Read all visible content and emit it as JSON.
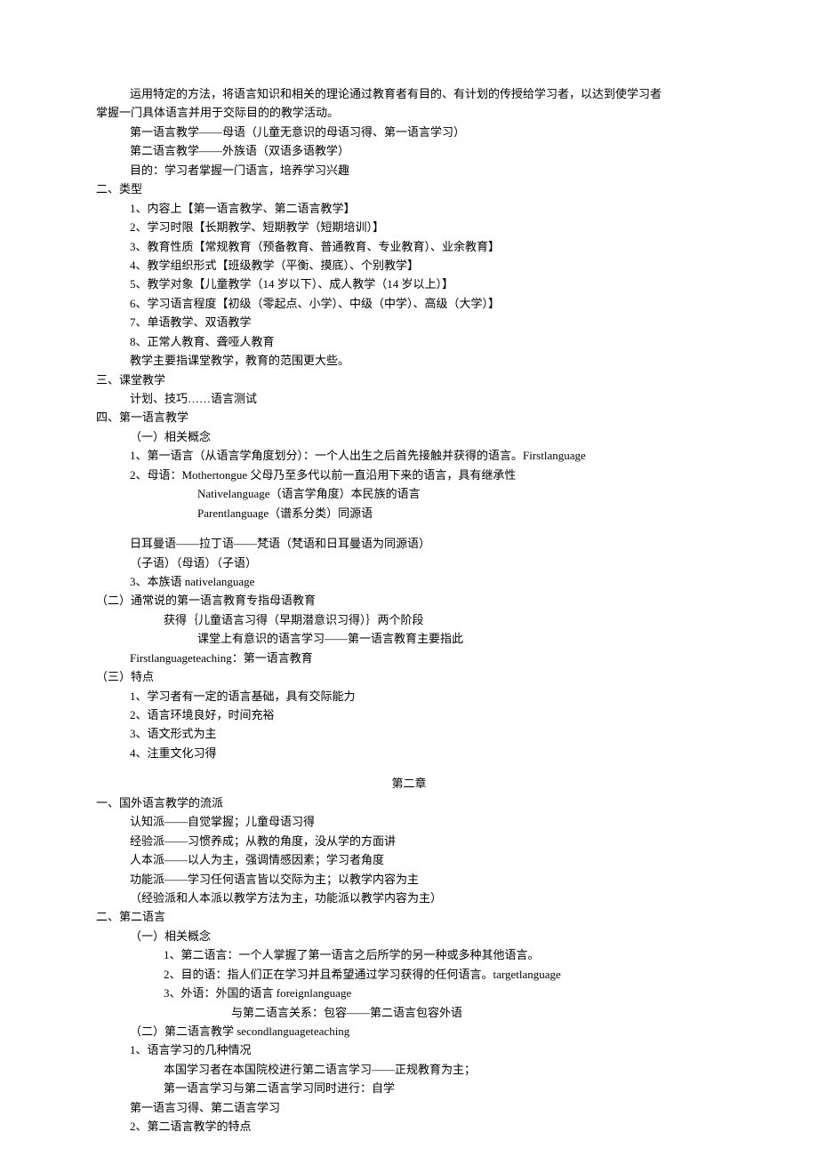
{
  "lines": [
    {
      "cls": "indent-1",
      "text": "运用特定的方法，将语言知识和相关的理论通过教育者有目的、有计划的传授给学习者，以达到使学习者"
    },
    {
      "cls": "section-num",
      "text": "掌握一门具体语言并用于交际目的的教学活动。"
    },
    {
      "cls": "indent-1",
      "text": "第一语言教学——母语（儿童无意识的母语习得、第一语言学习）"
    },
    {
      "cls": "indent-1",
      "text": "第二语言教学——外族语（双语多语教学）"
    },
    {
      "cls": "indent-1",
      "text": "目的：学习者掌握一门语言，培养学习兴趣"
    },
    {
      "cls": "section-num",
      "text": "二、类型"
    },
    {
      "cls": "indent-1",
      "text": "1、内容上【第一语言教学、第二语言教学】"
    },
    {
      "cls": "indent-1",
      "text": "2、学习时限【长期教学、短期教学（短期培训）】"
    },
    {
      "cls": "indent-1",
      "text": "3、教育性质【常规教育（预备教育、普通教育、专业教育）、业余教育】"
    },
    {
      "cls": "indent-1",
      "text": "4、教学组织形式【班级教学（平衡、摸底）、个别教学】"
    },
    {
      "cls": "indent-1",
      "text": "5、教学对象【儿童教学（14 岁以下）、成人教学（14 岁以上）】"
    },
    {
      "cls": "indent-1",
      "text": "6、学习语言程度【初级（零起点、小学）、中级（中学）、高级（大学）】"
    },
    {
      "cls": "indent-1",
      "text": "7、单语教学、双语教学"
    },
    {
      "cls": "indent-1",
      "text": "8、正常人教育、聋哑人教育"
    },
    {
      "cls": "indent-1",
      "text": "教学主要指课堂教学，教育的范围更大些。"
    },
    {
      "cls": "section-num",
      "text": "三、课堂教学"
    },
    {
      "cls": "indent-1",
      "text": "计划、技巧……语言测试"
    },
    {
      "cls": "section-num",
      "text": "四、第一语言教学"
    },
    {
      "cls": "indent-1",
      "text": "（一）相关概念"
    },
    {
      "cls": "indent-1",
      "text": "1、第一语言（从语言学角度划分）：一个人出生之后首先接触并获得的语言。Firstlanguage"
    },
    {
      "cls": "indent-1",
      "text": "2、母语：Mothertongue 父母乃至多代以前一直沿用下来的语言，具有继承性"
    },
    {
      "cls": "indent-4",
      "text": "Nativelanguage（语言学角度）本民族的语言"
    },
    {
      "cls": "indent-4",
      "text": "Parentlanguage（谱系分类）同源语"
    },
    {
      "cls": "spacer",
      "text": ""
    },
    {
      "cls": "indent-2",
      "text": "日耳曼语——拉丁语——梵语（梵语和日耳曼语为同源语）"
    },
    {
      "cls": "indent-2",
      "text": "（子语）（母语）（子语）"
    },
    {
      "cls": "indent-1",
      "text": "3、本族语 nativelanguage"
    },
    {
      "cls": "section-num",
      "text": "（二）通常说的第一语言教育专指母语教育"
    },
    {
      "cls": "indent-3",
      "text": "获得｛儿童语言习得（早期潜意识习得）｝两个阶段"
    },
    {
      "cls": "indent-4",
      "text": "课堂上有意识的语言学习——第一语言教育主要指此"
    },
    {
      "cls": "indent-2",
      "text": "Firstlanguageteaching：第一语言教育"
    },
    {
      "cls": "section-num",
      "text": "（三）特点"
    },
    {
      "cls": "indent-2",
      "text": "1、学习者有一定的语言基础，具有交际能力"
    },
    {
      "cls": "indent-2",
      "text": "2、语言环境良好，时间充裕"
    },
    {
      "cls": "indent-2",
      "text": "3、语文形式为主"
    },
    {
      "cls": "indent-2",
      "text": "4、注重文化习得"
    },
    {
      "cls": "spacer",
      "text": ""
    },
    {
      "cls": "center",
      "text": "第二章"
    },
    {
      "cls": "section-num",
      "text": "一、国外语言教学的流派"
    },
    {
      "cls": "indent-1",
      "text": "认知派——自觉掌握；儿童母语习得"
    },
    {
      "cls": "indent-1",
      "text": "经验派——习惯养成；从教的角度，没从学的方面讲"
    },
    {
      "cls": "indent-1",
      "text": "人本派——以人为主，强调情感因素；学习者角度"
    },
    {
      "cls": "indent-1",
      "text": "功能派——学习任何语言皆以交际为主；以教学内容为主"
    },
    {
      "cls": "indent-1",
      "text": "（经验派和人本派以教学方法为主，功能派以教学内容为主）"
    },
    {
      "cls": "section-num",
      "text": "二、第二语言"
    },
    {
      "cls": "indent-1",
      "text": "（一）相关概念"
    },
    {
      "cls": "indent-3",
      "text": "1、第二语言：一个人掌握了第一语言之后所学的另一种或多种其他语言。"
    },
    {
      "cls": "indent-3",
      "text": "2、目的语：指人们正在学习并且希望通过学习获得的任何语言。targetlanguage"
    },
    {
      "cls": "indent-3",
      "text": "3、外语：外国的语言 foreignlanguage"
    },
    {
      "cls": "indent-5",
      "text": "与第二语言关系：包容——第二语言包容外语"
    },
    {
      "cls": "indent-1",
      "text": "（二）第二语言教学 secondlanguageteaching"
    },
    {
      "cls": "indent-1",
      "text": "1、语言学习的几种情况"
    },
    {
      "cls": "indent-3",
      "text": "本国学习者在本国院校进行第二语言学习——正规教育为主；"
    },
    {
      "cls": "indent-3",
      "text": "第一语言学习与第二语言学习同时进行：自学"
    },
    {
      "cls": "indent-2",
      "text": "第一语言习得、第二语言学习"
    },
    {
      "cls": "indent-1",
      "text": "2、第二语言教学的特点"
    }
  ]
}
